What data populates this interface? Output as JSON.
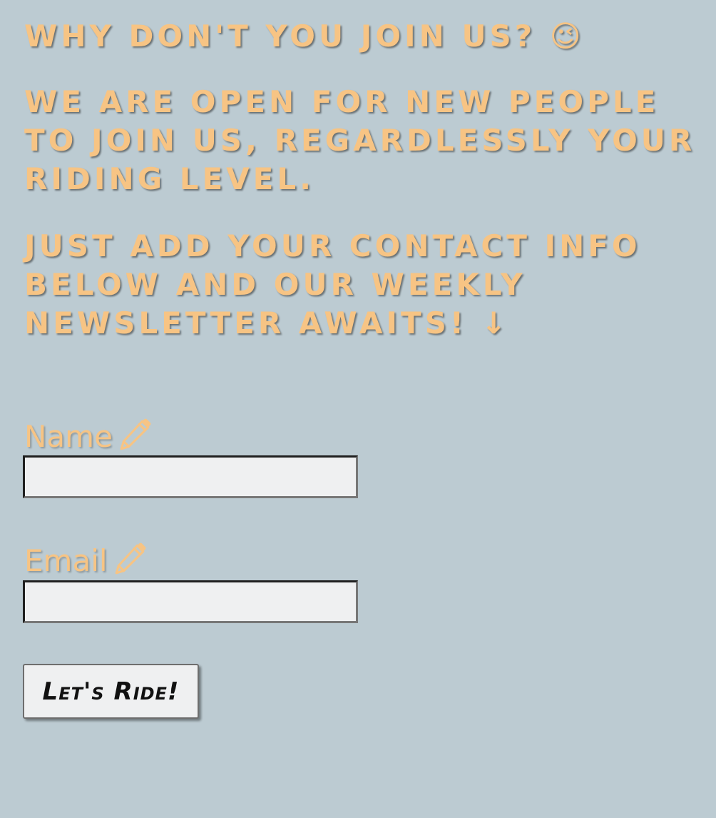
{
  "headings": {
    "title": "Why don't you join us?",
    "title_emoji": "😉",
    "intro_line1": "We are open for new people",
    "intro_line2": "to join us, regardlessly your",
    "intro_line3": "riding level.",
    "cta_line1": "Just add your contact info",
    "cta_line2": "below and our weekly",
    "cta_line3": "newsletter awaits!",
    "cta_arrow": "↓"
  },
  "form": {
    "name_label": "Name",
    "name_value": "",
    "email_label": "Email",
    "email_value": "",
    "label_icon": "pencil-icon",
    "submit_label": "Let's Ride!"
  },
  "colors": {
    "background": "#bccbd2",
    "accent": "#f7c484",
    "input_background": "#eff0f1"
  }
}
